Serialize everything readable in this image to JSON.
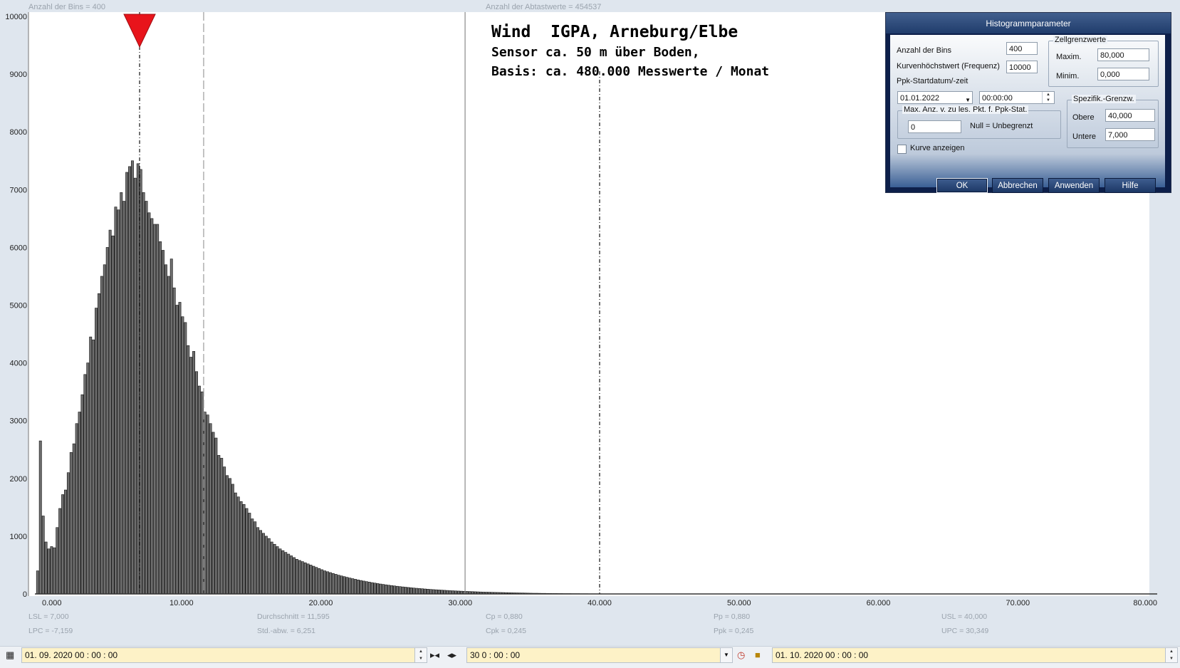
{
  "top_info": {
    "bins": "Anzahl der Bins =   400",
    "samples": "Anzahl der Abtastwerte = 454537"
  },
  "title": {
    "line1": "Wind  IGPA, Arneburg/Elbe",
    "line2": "Sensor ca. 50 m über Boden,",
    "line3": "Basis: ca. 480.000 Messwerte / Monat"
  },
  "stats": {
    "lsl": "LSL = 7,000",
    "lpc": "LPC = -7,159",
    "avg": "Durchschnitt  = 11,595",
    "std": "Std.-abw. = 6,251",
    "cp": "Cp  = 0,880",
    "cpk": "Cpk = 0,245",
    "pp": "Pp  = 0,880",
    "ppk": "Ppk = 0,245",
    "usl": "USL = 40,000",
    "upc": "UPC = 30,349"
  },
  "dialog": {
    "caption": "Histogrammparameter",
    "bins_label": "Anzahl der Bins",
    "bins_value": "400",
    "freq_label": "Kurvenhöchstwert (Frequenz)",
    "freq_value": "10000",
    "ppk_label": "Ppk-Startdatum/-zeit",
    "ppk_date": "01.01.2022",
    "ppk_time": "00:00:00",
    "cell_group": "Zellgrenzwerte",
    "max_label": "Maxim.",
    "max_value": "80,000",
    "min_label": "Minim.",
    "min_value": "0,000",
    "maxanz_group": "Max. Anz. v. zu les. Pkt. f. Ppk-Stat.",
    "maxanz_value": "0",
    "null_label": "Null = Unbegrenzt",
    "spec_group": "Spezifik.-Grenzw.",
    "upper_label": "Obere",
    "upper_value": "40,000",
    "lower_label": "Untere",
    "lower_value": "7,000",
    "curve_label": "Kurve anzeigen",
    "ok": "OK",
    "cancel": "Abbrechen",
    "apply": "Anwenden",
    "help": "Hilfe"
  },
  "bottom": {
    "start": "01. 09. 2020   00 : 00 : 00",
    "duration": "30  0 : 00 : 00",
    "end": "01. 10. 2020   00 : 00 : 00"
  },
  "colors": {
    "bar_fill": "#6e6e6e",
    "marker": "#e8141b",
    "axis": "#333333",
    "background": "#ffffff"
  },
  "chart_data": {
    "type": "bar",
    "title": "Wind  IGPA, Arneburg/Elbe",
    "xlim": [
      0,
      80000
    ],
    "ylim": [
      0,
      10000
    ],
    "bin_width": 200,
    "x_ticks": [
      "0,000",
      "10,000",
      "20,000",
      "30,000",
      "40,000",
      "50,000",
      "60,000",
      "70,000",
      "80,000"
    ],
    "y_ticks": [
      "0",
      "1000",
      "2000",
      "3000",
      "4000",
      "5000",
      "6000",
      "7000",
      "8000",
      "9000",
      "10000"
    ],
    "lines": {
      "lsl": 7000,
      "mean": 11595,
      "upc": 30349,
      "usl": 40000
    },
    "marker_x": 7000,
    "bins_start": [
      -400,
      -200,
      0,
      200,
      400,
      600,
      800,
      1000,
      1200,
      1400,
      1600,
      1800,
      2000,
      2200,
      2400,
      2600,
      2800,
      3000,
      3200,
      3400,
      3600,
      3800,
      4000,
      4200,
      4400,
      4600,
      4800,
      5000,
      5200,
      5400,
      5600,
      5800,
      6000,
      6200,
      6400,
      6600,
      6800,
      7000,
      7200,
      7400,
      7600,
      7800,
      8000,
      8200,
      8400,
      8600,
      8800,
      9000,
      9200,
      9400,
      9600,
      9800,
      10000,
      10200,
      10400,
      10600,
      10800,
      11000,
      11200,
      11400,
      11600,
      11800,
      12000,
      12200,
      12400,
      12600,
      12800,
      13000,
      13200,
      13400,
      13600,
      13800,
      14000,
      14200,
      14400,
      14600,
      14800,
      15000,
      15200,
      15400,
      15600,
      15800,
      16000,
      16200,
      16400,
      16600,
      16800,
      17000,
      17200,
      17400,
      17600,
      17800,
      18000,
      18200,
      18400,
      18600,
      18800,
      19000,
      19200,
      19400,
      19600,
      19800,
      20000,
      20200,
      20400,
      20600,
      20800,
      21000,
      21200,
      21400,
      21600,
      21800,
      22000,
      22200,
      22400,
      22600,
      22800,
      23000,
      23200,
      23400,
      23600,
      23800,
      24000,
      24200,
      24400,
      24600,
      24800,
      25000,
      25200,
      25400,
      25600,
      25800,
      26000,
      26200,
      26400,
      26600,
      26800,
      27000,
      27200,
      27400,
      27600,
      27800,
      28000,
      28200,
      28400,
      28600,
      28800,
      29000,
      29200,
      29400,
      29600,
      29800,
      30000,
      30200,
      30400,
      30600,
      30800,
      31000,
      31200,
      31400,
      31600,
      31800,
      32000,
      32200,
      32400,
      32600,
      32800,
      33000,
      33200,
      33400,
      33600,
      33800,
      34000,
      34200,
      34400,
      34600,
      34800,
      35000,
      35200,
      35400,
      35600,
      35800,
      36000,
      36200,
      36400,
      36600,
      36800,
      37000,
      37200,
      37400,
      37600,
      37800,
      38000,
      38200,
      38400,
      38600,
      38800,
      39000,
      39200,
      39400,
      39600,
      39800,
      40000,
      40200,
      40400,
      40600,
      40800,
      41000,
      41200,
      41400,
      41600,
      41800,
      42000,
      42200,
      42400,
      42600,
      42800,
      43000,
      43200,
      43400,
      43600,
      43800,
      44000,
      44200,
      44400,
      44600,
      44800,
      45000,
      45200,
      45400,
      45600,
      45800,
      46000
    ],
    "values": [
      400,
      2650,
      1350,
      900,
      780,
      820,
      800,
      1150,
      1480,
      1720,
      1800,
      2100,
      2450,
      2600,
      2950,
      3150,
      3450,
      3800,
      4000,
      4450,
      4400,
      4950,
      5200,
      5500,
      5700,
      6000,
      6300,
      6200,
      6700,
      6650,
      6950,
      6800,
      7300,
      7400,
      7500,
      7200,
      7450,
      7350,
      6950,
      6800,
      6600,
      6500,
      6400,
      6400,
      6100,
      5950,
      5700,
      5500,
      5800,
      5300,
      5000,
      5050,
      4800,
      4700,
      4300,
      4100,
      4200,
      3850,
      3600,
      3500,
      3150,
      3100,
      2950,
      2800,
      2700,
      2400,
      2350,
      2200,
      2050,
      2000,
      1900,
      1750,
      1680,
      1600,
      1550,
      1480,
      1400,
      1300,
      1250,
      1150,
      1100,
      1050,
      1000,
      960,
      900,
      860,
      820,
      780,
      750,
      720,
      690,
      660,
      630,
      600,
      580,
      560,
      540,
      520,
      500,
      480,
      460,
      440,
      420,
      400,
      385,
      370,
      355,
      340,
      325,
      312,
      300,
      288,
      276,
      265,
      254,
      243,
      233,
      223,
      214,
      205,
      196,
      188,
      180,
      172,
      165,
      158,
      151,
      145,
      139,
      133,
      127,
      122,
      117,
      112,
      107,
      102,
      98,
      94,
      90,
      86,
      82,
      78,
      75,
      72,
      69,
      66,
      63,
      60,
      57,
      55,
      52,
      50,
      48,
      46,
      44,
      42,
      40,
      38,
      36,
      34,
      32,
      31,
      30,
      28,
      27,
      26,
      25,
      24,
      22,
      21,
      20,
      19,
      18,
      17,
      16,
      15,
      14,
      13,
      12,
      12,
      11,
      10,
      10,
      9,
      9,
      8,
      8,
      7,
      7,
      6,
      6,
      6,
      5,
      5,
      5,
      4,
      4,
      4,
      3,
      3,
      3,
      3,
      3,
      2,
      2,
      2,
      2,
      2,
      2,
      2,
      2,
      1,
      1,
      1,
      1,
      1,
      1,
      1,
      1,
      1,
      1,
      1,
      1,
      1,
      1,
      1,
      1,
      1,
      1
    ]
  }
}
